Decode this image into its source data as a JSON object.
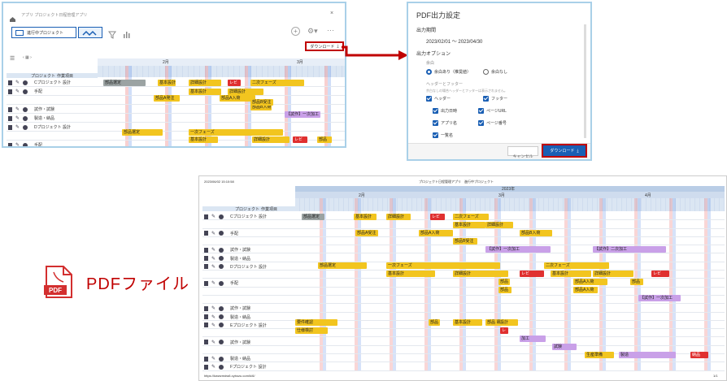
{
  "app": {
    "breadcrumb": "アプリ プロジェクト日程管理アプリ",
    "view_selector": "進行中プロジェクト",
    "download_label": "ダウンロード",
    "month_feb": "2月",
    "month_mar": "3月",
    "header_project": "プロジェクト",
    "header_task": "作業項目"
  },
  "rows_top": [
    {
      "label": "Cプロジェクト 設計",
      "icons": true
    },
    {
      "label": "手配",
      "icons": true
    },
    {
      "label": "",
      "icons": false
    },
    {
      "label": "試作・試験",
      "icons": true
    },
    {
      "label": "製造・納品",
      "icons": true
    },
    {
      "label": "Dプロジェクト 設計",
      "icons": true
    },
    {
      "label": "",
      "icons": false
    },
    {
      "label": "手配",
      "icons": true
    }
  ],
  "bars_top": [
    {
      "text": "部品選定",
      "c": "g"
    },
    {
      "text": "基本設計",
      "c": "y"
    },
    {
      "text": "詳細設計",
      "c": "y"
    },
    {
      "text": "レビ",
      "c": "r"
    },
    {
      "text": "二次フェーズ",
      "c": "y"
    },
    {
      "text": "基本設計",
      "c": "y"
    },
    {
      "text": "詳細設計",
      "c": "y"
    },
    {
      "text": "部品A発注",
      "c": "y"
    },
    {
      "text": "部品A入荷",
      "c": "y"
    },
    {
      "text": "部品B入荷",
      "c": "y"
    },
    {
      "text": "部品B受注",
      "c": "y"
    },
    {
      "text": "【試作】一次加工",
      "c": "p"
    },
    {
      "text": "部品選定",
      "c": "y"
    },
    {
      "text": "一次フェーズ",
      "c": "y"
    },
    {
      "text": "基本設計",
      "c": "y"
    },
    {
      "text": "詳細設計",
      "c": "y"
    },
    {
      "text": "レビ",
      "c": "r"
    },
    {
      "text": "部品",
      "c": "y"
    }
  ],
  "dialog": {
    "title": "PDF出力設定",
    "period_label": "出力期間",
    "period_value": "2023/02/01 ～ 2023/04/30",
    "options_label": "出力オプション",
    "margin_label": "余白",
    "margin_yes": "余白あり（推奨値）",
    "margin_no": "余白なし",
    "hf_label": "ヘッダーとフッター",
    "hf_note": "余白なしの場合ヘッダーとフッターは表示されません。",
    "header_cb": "ヘッダー",
    "footer_cb": "フッター",
    "opt_date": "出力日時",
    "opt_url": "ページURL",
    "opt_appname": "アプリ名",
    "opt_pageno": "ページ番号",
    "opt_viewname": "一覧名",
    "cancel": "キャンセル",
    "download": "ダウンロード"
  },
  "pdf": {
    "timestamp": "2023/06/02 15:10:58",
    "doc_title": "プロジェクト日程管理アプリ　進行中プロジェクト",
    "year": "2023年",
    "m2": "2月",
    "m3": "3月",
    "m4": "4月",
    "header_project": "プロジェクト",
    "header_task": "作業項目",
    "footer_url": "https://kwwzmdw6.cybozu.com/k/6/",
    "footer_page": "1/1"
  },
  "pdf_rows": [
    {
      "label": "Cプロジェクト 設計",
      "icons": true
    },
    {
      "label": "",
      "icons": false
    },
    {
      "label": "手配",
      "icons": true
    },
    {
      "label": "",
      "icons": false
    },
    {
      "label": "試作・試験",
      "icons": true
    },
    {
      "label": "製造・納品",
      "icons": true
    },
    {
      "label": "Dプロジェクト 設計",
      "icons": true
    },
    {
      "label": "",
      "icons": false
    },
    {
      "label": "手配",
      "icons": true
    },
    {
      "label": "",
      "icons": false
    },
    {
      "label": "",
      "icons": false
    },
    {
      "label": "試作・試験",
      "icons": true
    },
    {
      "label": "製造・納品",
      "icons": true
    },
    {
      "label": "Eプロジェクト 設計",
      "icons": true
    },
    {
      "label": "",
      "icons": false
    },
    {
      "label": "試作・試験",
      "icons": true
    },
    {
      "label": "",
      "icons": false
    },
    {
      "label": "製造・納品",
      "icons": true
    },
    {
      "label": "Fプロジェクト 設計",
      "icons": true
    }
  ],
  "pdf_bars": [
    {
      "text": "部品選定",
      "c": "g"
    },
    {
      "text": "基本設計",
      "c": "y"
    },
    {
      "text": "詳細設計",
      "c": "y"
    },
    {
      "text": "レビ",
      "c": "r"
    },
    {
      "text": "二次フェーズ",
      "c": "y"
    },
    {
      "text": "基本設計",
      "c": "y"
    },
    {
      "text": "詳細設計",
      "c": "y"
    },
    {
      "text": "部品A受注",
      "c": "y"
    },
    {
      "text": "部品A入荷",
      "c": "y"
    },
    {
      "text": "部品B入荷",
      "c": "y"
    },
    {
      "text": "部品B受注",
      "c": "y"
    },
    {
      "text": "【試作】一次加工",
      "c": "p"
    },
    {
      "text": "【試作】二次加工",
      "c": "p"
    },
    {
      "text": "部品選定",
      "c": "y"
    },
    {
      "text": "一次フェーズ",
      "c": "y"
    },
    {
      "text": "二次フェーズ",
      "c": "y"
    },
    {
      "text": "基本設計",
      "c": "y"
    },
    {
      "text": "詳細設計",
      "c": "y"
    },
    {
      "text": "レビ",
      "c": "r"
    },
    {
      "text": "基本設計",
      "c": "y"
    },
    {
      "text": "詳細設計",
      "c": "y"
    },
    {
      "text": "レビ",
      "c": "r"
    },
    {
      "text": "部品",
      "c": "y"
    },
    {
      "text": "部品A入荷",
      "c": "y"
    },
    {
      "text": "部品",
      "c": "y"
    },
    {
      "text": "部品A入荷",
      "c": "y"
    },
    {
      "text": "部品",
      "c": "y"
    },
    {
      "text": "【試作】一次加工",
      "c": "p"
    },
    {
      "text": "要件確認",
      "c": "y"
    },
    {
      "text": "部品",
      "c": "y"
    },
    {
      "text": "基本設計",
      "c": "y"
    },
    {
      "text": "詳細設計",
      "c": "y"
    },
    {
      "text": "仕様検討",
      "c": "y"
    },
    {
      "text": "レ",
      "c": "r"
    },
    {
      "text": "加工",
      "c": "p"
    },
    {
      "text": "試験",
      "c": "p"
    },
    {
      "text": "部品",
      "c": "y"
    },
    {
      "text": "生産準備",
      "c": "y"
    },
    {
      "text": "製造",
      "c": "p"
    },
    {
      "text": "納品",
      "c": "r"
    }
  ],
  "pdf_label": "PDFファイル",
  "colors": {
    "accent": "#1a5fb4",
    "highlight": "#c00000",
    "pdf_red": "#d32f2f"
  }
}
